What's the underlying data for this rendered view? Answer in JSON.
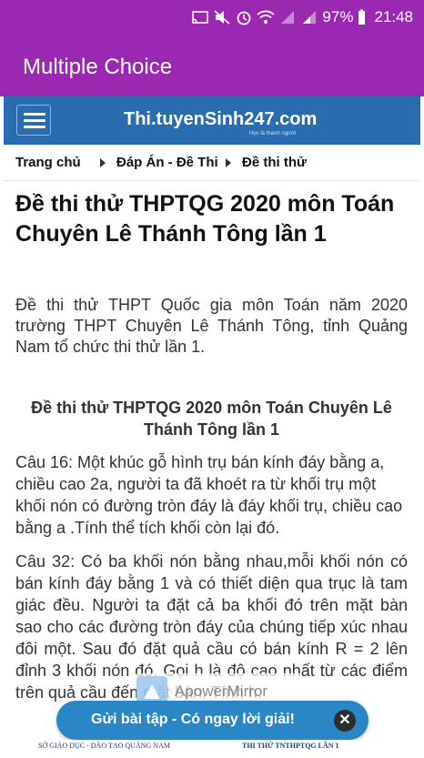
{
  "status_bar": {
    "battery": "97%",
    "time": "21:48"
  },
  "app_bar": {
    "title": "Multiple Choice"
  },
  "site": {
    "logo": "Thi.tuyenSinh247.com",
    "logo_tagline": "Học là thành người"
  },
  "breadcrumb": [
    "Trang chủ",
    "Đáp Án - Đề Thi",
    "Đề thi thử"
  ],
  "article": {
    "title": "Đề thi thử THPTQG 2020 môn Toán Chuyên Lê Thánh Tông lần 1",
    "intro": "Đề thi thử THPT Quốc gia môn Toán năm 2020 trường THPT Chuyên Lê Thánh Tông, tỉnh Quảng Nam tổ chức thi thử lần 1.",
    "subheading": "Đề thi thử THPTQG 2020 môn Toán Chuyên Lê Thánh Tông lần 1",
    "q16": "Câu 16: Một khúc gỗ hình trụ bán kính đáy bằng a, chiều cao 2a, người ta đã khoét ra từ khối trụ một khối nón có đường tròn đáy là đáy khối trụ, chiều cao bằng a .Tính thể tích khối còn lại đó.",
    "q32": "Câu 32: Có ba khối nón bằng nhau,mỗi khối nón có bán kính đáy bằng 1 và có thiết diện qua trục là tam giác đều. Người ta đặt cả ba khối đó trên mặt bàn sao cho các đường tròn đáy của chúng tiếp xúc nhau đôi một. Sau đó đặt quả cầu có bán kính R = 2 lên đỉnh 3 khối nón đó. Gọi h là độ cao nhất từ các điểm trên quả cầu đến mặt bàn. Tính h."
  },
  "watermark": "ApowerMirror",
  "cta": {
    "label": "Gửi bài tập - Có ngay lời giải!"
  },
  "footer_strip": {
    "left": "SỞ GIÁO DỤC - ĐÀO TẠO QUẢNG NAM",
    "right": "THI THỬ TNTHPTQG LẦN 1"
  },
  "colors": {
    "app_bar": "#9b28b1",
    "site_header": "#2a6cb0",
    "cta": "#2b86c5"
  }
}
